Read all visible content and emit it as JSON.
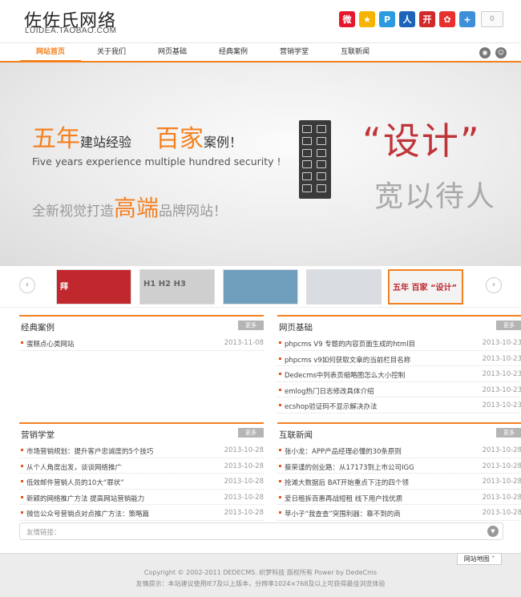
{
  "header": {
    "logo_title": "佐佐氏网络",
    "logo_sub": "LUIDEA.TAOBAO.COM",
    "share_count": "0",
    "share_icons": [
      {
        "name": "weibo-icon",
        "glyph": "微",
        "color": "#e6162d"
      },
      {
        "name": "qzone-icon",
        "glyph": "★",
        "color": "#f5b400"
      },
      {
        "name": "tencent-weibo-icon",
        "glyph": "P",
        "color": "#2b9be0"
      },
      {
        "name": "renren-icon",
        "glyph": "人",
        "color": "#1c64b8"
      },
      {
        "name": "kaixin-icon",
        "glyph": "开",
        "color": "#d12a2a"
      },
      {
        "name": "qq-friend-icon",
        "glyph": "✿",
        "color": "#e8312e"
      },
      {
        "name": "plus-share-icon",
        "glyph": "+",
        "color": "#3d8fd8"
      }
    ]
  },
  "nav": {
    "items": [
      "网站首页",
      "关于我们",
      "网页基础",
      "经典案例",
      "营销学堂",
      "互联新闻"
    ]
  },
  "banner": {
    "line1_a": "五年",
    "line1_b": "建站经验",
    "line1_c": "百家",
    "line1_d": "案例！",
    "line2": "Five years experience multiple hundred security !",
    "line3_a": "全新视觉打造",
    "line3_b": "高端",
    "line3_c": "品牌网站！",
    "design_word": "“设计”",
    "slogan": "宽以待人"
  },
  "thumbs": [
    {
      "label": "拜",
      "bg": "#c0282d",
      "fg": "#fff"
    },
    {
      "label": "H1  H2  H3",
      "bg": "#cfcfcf",
      "fg": "#666"
    },
    {
      "label": "",
      "bg": "#6f9fbd",
      "fg": "#fff"
    },
    {
      "label": "",
      "bg": "#d9dde2",
      "fg": "#555"
    },
    {
      "label": "五年 百家 “设计”",
      "bg": "#f3f3f3",
      "fg": "#c0282d"
    }
  ],
  "sections": {
    "cases": {
      "title": "经典案例",
      "more": "更多",
      "items": [
        {
          "text": "蛋糕点心类网站",
          "date": "2013-11-08"
        }
      ]
    },
    "basics": {
      "title": "网页基础",
      "more": "更多",
      "items": [
        {
          "text": "phpcms V9 专题的内容页面生成的html目",
          "date": "2013-10-23"
        },
        {
          "text": "phpcms v9如何获取文章的当前栏目名称",
          "date": "2013-10-23"
        },
        {
          "text": "Dedecms中列表页缩略图怎么大小控制",
          "date": "2013-10-23"
        },
        {
          "text": "emlog热门日志修改具体介绍",
          "date": "2013-10-23"
        },
        {
          "text": "ecshop验证码不显示解决办法",
          "date": "2013-10-23"
        }
      ]
    },
    "marketing": {
      "title": "营销学堂",
      "more": "更多",
      "items": [
        {
          "text": "市场营销规划：提升客户忠诚度的5个技巧",
          "date": "2013-10-28"
        },
        {
          "text": "从个人角度出发，谈谈网络推广",
          "date": "2013-10-28"
        },
        {
          "text": "低效邮件营销人员的10大“罪状”",
          "date": "2013-10-28"
        },
        {
          "text": "新颖的网络推广方法 提高网站营销能力",
          "date": "2013-10-28"
        },
        {
          "text": "微信公众号营销点对点推广方法：策略篇",
          "date": "2013-10-28"
        }
      ]
    },
    "news": {
      "title": "互联新闻",
      "more": "更多",
      "items": [
        {
          "text": "张小龙：APP产品经理必懂的30条原则",
          "date": "2013-10-28"
        },
        {
          "text": "蔡荣谨的创业路：从17173到上市公司IGG",
          "date": "2013-10-28"
        },
        {
          "text": "抢滩大数据后 BAT开始重点下注的四个领",
          "date": "2013-10-28"
        },
        {
          "text": "爱日租拆百惠再战短租 线下用户找优质",
          "date": "2013-10-28"
        },
        {
          "text": "苹小子“我查查”突围利器：靠不到的商",
          "date": "2013-10-28"
        }
      ]
    }
  },
  "links": {
    "label": "友情链接："
  },
  "footer": {
    "sitemap": "网站地图 ˄",
    "copyright": "Copyright © 2002-2011 DEDECMS. 织梦科技 版权所有 Power by DedeCms",
    "tip": "友情提示：本站建议使用IE7及以上版本，分辨率1024×768及以上可获得最佳浏览体验"
  }
}
